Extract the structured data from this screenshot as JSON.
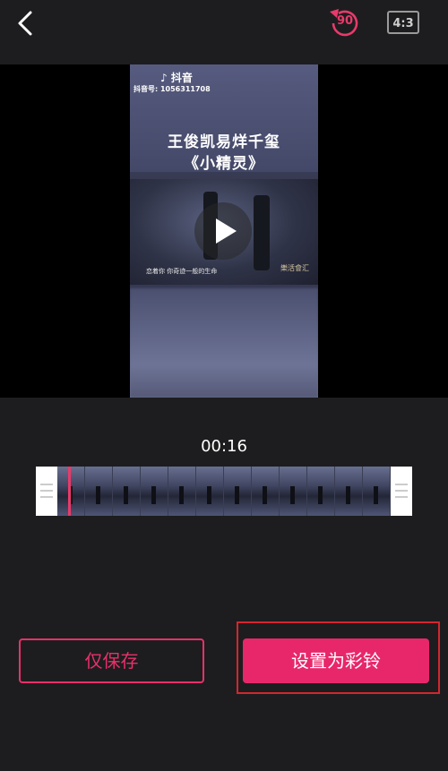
{
  "header": {
    "back_icon": "chevron-left-icon",
    "rotate_icon": "rotate-ccw-icon",
    "rotate_label": "90",
    "ratio_label": "4:3",
    "accent_color": "#e83a6a"
  },
  "video": {
    "platform_name": "抖音",
    "account_id": "抖音号: 1056311708",
    "title_line1": "王俊凯易烊千玺",
    "title_line2": "《小精灵》",
    "subtitle": "恋着你 你奇迹一般的生命",
    "watermark": "樂活會汇",
    "play_icon": "play-icon"
  },
  "timeline": {
    "current_time": "00:16",
    "frame_count": 12,
    "handle_icon": "drag-handle-icon"
  },
  "actions": {
    "save_only_label": "仅保存",
    "set_ringtone_label": "设置为彩铃",
    "primary_color": "#e8276a"
  }
}
